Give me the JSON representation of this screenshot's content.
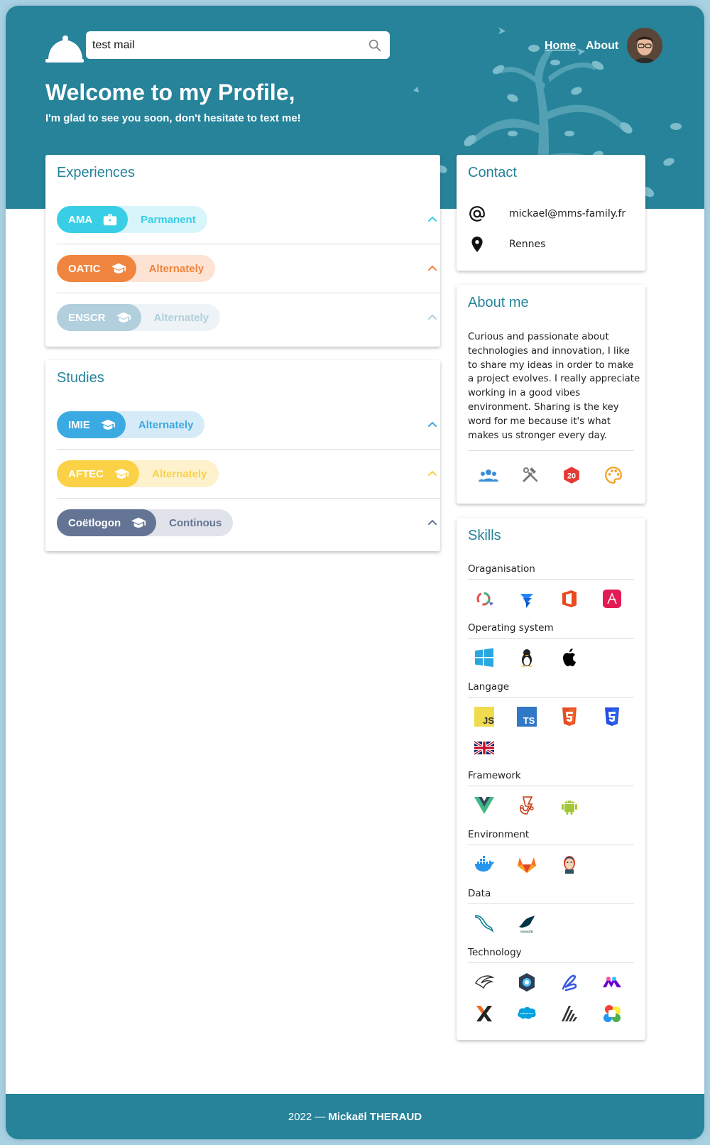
{
  "header": {
    "search_value": "test mail",
    "nav": {
      "home": "Home",
      "about": "About"
    },
    "welcome": "Welcome to my Profile,",
    "subtitle": "I'm glad to see you soon, don't hesitate to text me!"
  },
  "colors": {
    "primary": "#26839a"
  },
  "experiences": {
    "title": "Experiences",
    "items": [
      {
        "name": "AMA",
        "tag": "Parmanent",
        "icon": "briefcase-icon",
        "color": "#38cfe6",
        "light": "#d8f5fa",
        "tagColor": "#38cfe6"
      },
      {
        "name": "OATIC",
        "tag": "Alternately",
        "icon": "graduation-cap-icon",
        "color": "#f0853f",
        "light": "#fde3d4",
        "tagColor": "#f0853f"
      },
      {
        "name": "ENSCR",
        "tag": "Alternately",
        "icon": "graduation-cap-icon",
        "color": "#b1cfdd",
        "light": "#edf3f6",
        "tagColor": "#b1cfdd"
      }
    ]
  },
  "studies": {
    "title": "Studies",
    "items": [
      {
        "name": "IMIE",
        "tag": "Alternately",
        "icon": "graduation-cap-icon",
        "color": "#3ba9e2",
        "light": "#d6ebf8",
        "tagColor": "#3ba9e2"
      },
      {
        "name": "AFTEC",
        "tag": "Alternately",
        "icon": "graduation-cap-icon",
        "color": "#fbd146",
        "light": "#fdf2cc",
        "tagColor": "#fbd146"
      },
      {
        "name": "Coëtlogon",
        "tag": "Continous",
        "icon": "graduation-cap-icon",
        "color": "#647494",
        "light": "#e0e3ea",
        "tagColor": "#647494"
      }
    ]
  },
  "contact": {
    "title": "Contact",
    "email": "mickael@mms-family.fr",
    "city": "Rennes"
  },
  "about": {
    "title": "About me",
    "text": "Curious and passionate about technologies and innovation, I like to share my ideas in order to make a project evolves. I really appreciate working in a good vibes environment. Sharing is the key word for me because it's what makes us stronger every day.",
    "hobby_badge": "20"
  },
  "skills": {
    "title": "Skills",
    "categories": [
      {
        "name": "Oraganisation",
        "icons": [
          "loop-icon",
          "jira-icon",
          "office-icon",
          "affinity-icon"
        ]
      },
      {
        "name": "Operating system",
        "icons": [
          "windows-icon",
          "linux-icon",
          "apple-icon"
        ]
      },
      {
        "name": "Langage",
        "icons": [
          "javascript-icon",
          "typescript-icon",
          "html5-icon",
          "css3-icon",
          "english-flag-icon"
        ],
        "labels": {
          "js": "JS",
          "ts": "TS"
        }
      },
      {
        "name": "Framework",
        "icons": [
          "vue-icon",
          "jest-icon",
          "android-icon"
        ]
      },
      {
        "name": "Environment",
        "icons": [
          "docker-icon",
          "gitlab-icon",
          "jenkins-icon"
        ]
      },
      {
        "name": "Data",
        "icons": [
          "mysql-icon",
          "mariadb-icon"
        ]
      },
      {
        "name": "Technology",
        "icons": [
          "hapi-icon",
          "ionic-icon",
          "loom-icon",
          "make-icon",
          "xcode-x-icon",
          "salesforce-icon",
          "sonar-icon",
          "webrtc-icon"
        ]
      }
    ]
  },
  "footer": {
    "year": "2022 —",
    "author": "Mickaël THERAUD"
  }
}
